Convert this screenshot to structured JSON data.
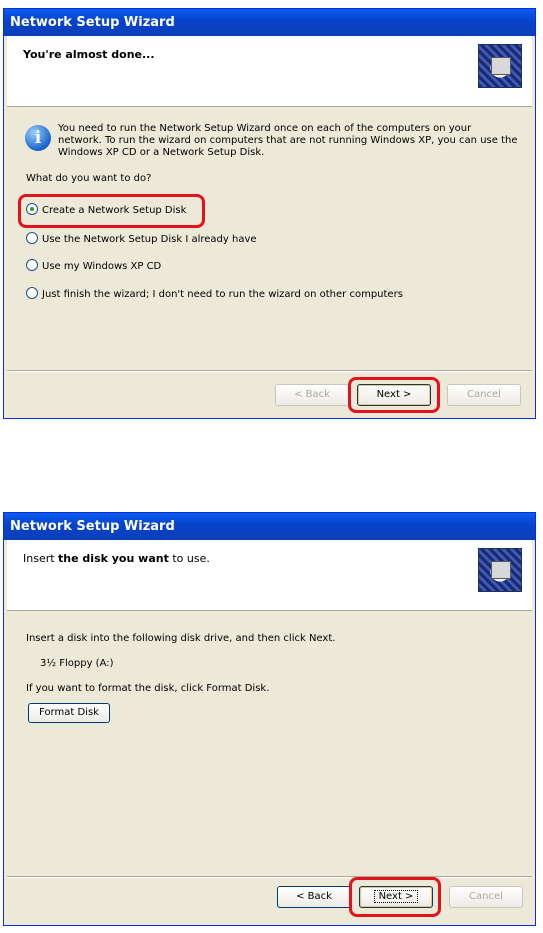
{
  "wizard1": {
    "title": "Network Setup Wizard",
    "header_title": "You're almost done...",
    "intro_text": "You need to run the Network Setup Wizard once on each of the computers on your network. To run the wizard on computers that are not running Windows XP, you can use the Windows XP CD or a Network Setup Disk.",
    "question": "What do you want to do?",
    "options": [
      {
        "label": "Create a Network Setup Disk",
        "checked": true
      },
      {
        "label": "Use the Network Setup Disk I already have",
        "checked": false
      },
      {
        "label": "Use my Windows XP CD",
        "checked": false
      },
      {
        "label": "Just finish the wizard; I don't need to run the wizard on other computers",
        "checked": false
      }
    ],
    "buttons": {
      "back": "< Back",
      "next": "Next >",
      "cancel": "Cancel"
    }
  },
  "wizard2": {
    "title": "Network Setup Wizard",
    "header_title_prefix": "Insert ",
    "header_title_bold": "the disk you want",
    "header_title_suffix": " to use.",
    "instruction": "Insert a disk into the following disk drive, and then click Next.",
    "drive": "3½ Floppy (A:)",
    "format_hint": "If you want to format the disk, click Format Disk.",
    "format_button": "Format Disk",
    "buttons": {
      "back": "< Back",
      "next": "Next >",
      "cancel": "Cancel"
    }
  },
  "colors": {
    "highlight": "#e4121c",
    "titlebar": "#0842c9",
    "dialog_bg": "#ece9d8"
  }
}
